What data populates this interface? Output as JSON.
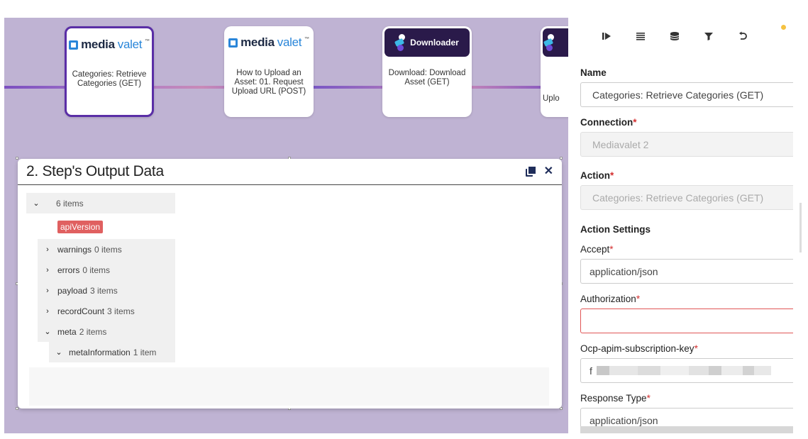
{
  "canvas": {
    "nodes": [
      {
        "type": "mediavalet",
        "logo_bold": "media",
        "logo_light": "valet",
        "logo_tm": "™",
        "label": "Categories: Retrieve Categories (GET)",
        "selected": true
      },
      {
        "type": "mediavalet",
        "logo_bold": "media",
        "logo_light": "valet",
        "logo_tm": "™",
        "label": "How to Upload an Asset: 01. Request Upload URL (POST)",
        "selected": false
      },
      {
        "type": "downloader",
        "logo_text": "Downloader",
        "label": "Download: Download Asset (GET)",
        "selected": false
      },
      {
        "type": "downloader",
        "label_partial": "Uplo",
        "selected": false
      }
    ]
  },
  "output_panel": {
    "title": "2. Step's Output Data",
    "tree": {
      "root": {
        "key": "",
        "count": "6 items"
      },
      "tag": "apiVersion",
      "children": [
        {
          "key": "warnings",
          "count": "0 items",
          "expanded": false
        },
        {
          "key": "errors",
          "count": "0 items",
          "expanded": false
        },
        {
          "key": "payload",
          "count": "3 items",
          "expanded": false
        },
        {
          "key": "recordCount",
          "count": "3 items",
          "expanded": false
        },
        {
          "key": "meta",
          "count": "2 items",
          "expanded": true
        }
      ],
      "grandchild": {
        "key": "metaInformation",
        "count": "1 item",
        "expanded": true
      }
    }
  },
  "right_panel": {
    "toolbar": [
      "step-forward-icon",
      "list-icon",
      "database-icon",
      "filter-icon",
      "undo-icon"
    ],
    "status_dot_color": "#f5c242",
    "name_label": "Name",
    "name_value": "Categories: Retrieve Categories (GET)",
    "connection_label": "Connection",
    "connection_value": "Mediavalet 2",
    "action_label": "Action",
    "action_value": "Categories: Retrieve Categories (GET)",
    "action_settings_label": "Action Settings",
    "accept_label": "Accept",
    "accept_value": "application/json",
    "authorization_label": "Authorization",
    "authorization_value": "",
    "ocp_label": "Ocp-apim-subscription-key",
    "ocp_value_prefix": "f",
    "response_type_label": "Response Type",
    "response_type_value": "application/json",
    "required_marker": "*"
  }
}
